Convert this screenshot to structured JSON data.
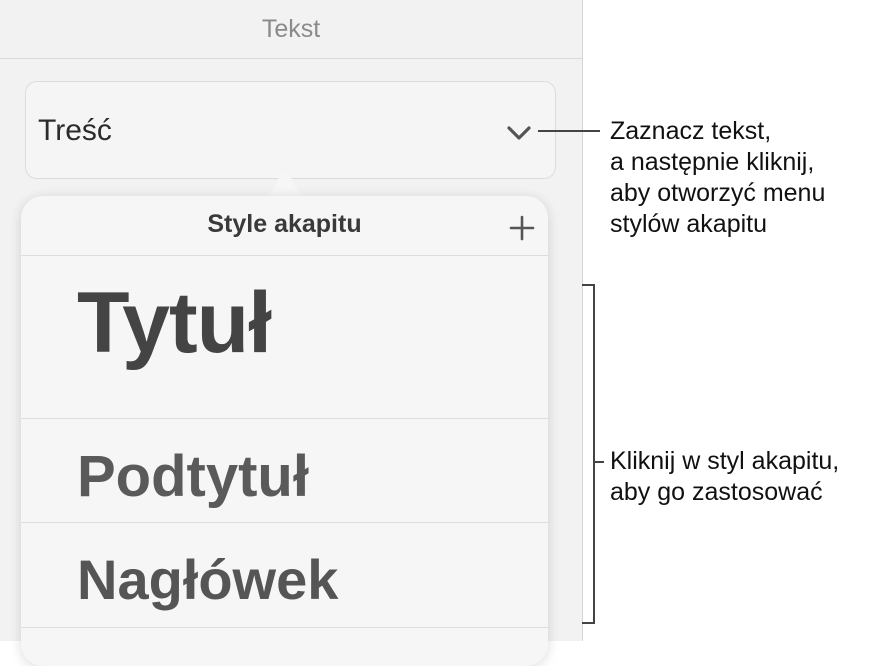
{
  "panel": {
    "title": "Tekst",
    "style_selector": {
      "value": "Treść"
    }
  },
  "popover": {
    "title": "Style akapitu",
    "styles": [
      {
        "label": "Tytuł"
      },
      {
        "label": "Podtytuł"
      },
      {
        "label": "Nagłówek"
      }
    ]
  },
  "callouts": {
    "open_menu": [
      "Zaznacz tekst,",
      "a następnie kliknij,",
      "aby otworzyć menu",
      "stylów akapitu"
    ],
    "apply_style": [
      "Kliknij w styl akapitu,",
      "aby go zastosować"
    ]
  },
  "icons": {
    "chevron": "chevron-down-icon",
    "add": "plus-icon"
  }
}
